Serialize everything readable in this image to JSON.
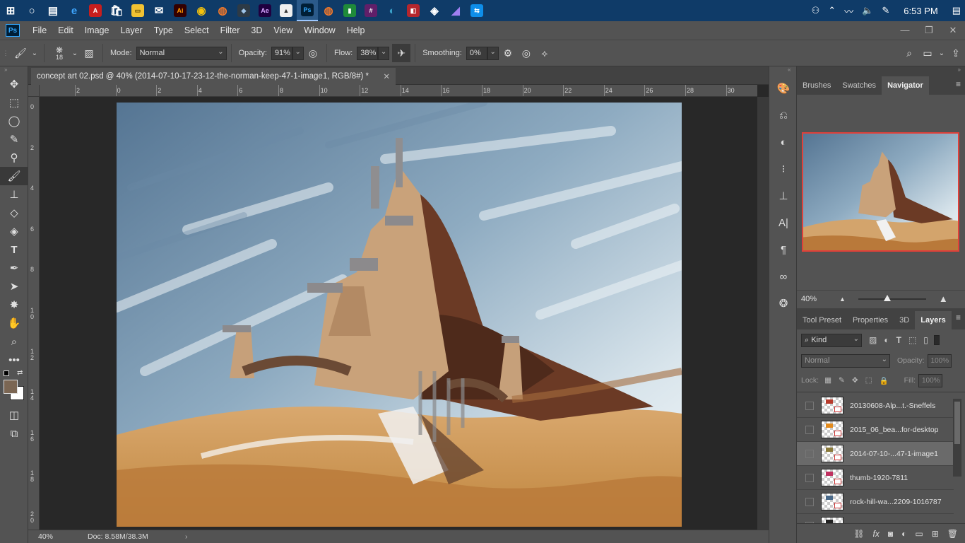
{
  "taskbar": {
    "apps": [
      {
        "icon": "windows-start-icon",
        "glyph": "⊞",
        "bg": "transparent",
        "fg": "#ffffff"
      },
      {
        "icon": "cortana-icon",
        "glyph": "○",
        "bg": "transparent",
        "fg": "#ffffff"
      },
      {
        "icon": "task-view-icon",
        "glyph": "▤",
        "bg": "transparent",
        "fg": "#ffffff"
      },
      {
        "icon": "edge-icon",
        "glyph": "e",
        "bg": "transparent",
        "fg": "#3ea6ff"
      },
      {
        "icon": "acrobat-icon",
        "glyph": "A",
        "bg": "#c81e1e",
        "fg": "#ffffff"
      },
      {
        "icon": "store-icon",
        "glyph": "🛍",
        "bg": "transparent",
        "fg": "#ffffff"
      },
      {
        "icon": "file-explorer-icon",
        "glyph": "▭",
        "bg": "#f1c232",
        "fg": "#5a4300"
      },
      {
        "icon": "mail-icon",
        "glyph": "✉",
        "bg": "transparent",
        "fg": "#ffffff"
      },
      {
        "icon": "illustrator-icon",
        "glyph": "Ai",
        "bg": "#330000",
        "fg": "#ff9a00"
      },
      {
        "icon": "chrome-icon",
        "glyph": "◉",
        "bg": "transparent",
        "fg": "#f4c20d"
      },
      {
        "icon": "blender-icon",
        "glyph": "◍",
        "bg": "transparent",
        "fg": "#f5792a"
      },
      {
        "icon": "app-icon",
        "glyph": "◆",
        "bg": "#2d3a46",
        "fg": "#9fc4e8"
      },
      {
        "icon": "after-effects-icon",
        "glyph": "Ae",
        "bg": "#1f0040",
        "fg": "#d7a3ff"
      },
      {
        "icon": "image-app-icon",
        "glyph": "▲",
        "bg": "#efefef",
        "fg": "#333333"
      },
      {
        "icon": "photoshop-icon",
        "glyph": "Ps",
        "bg": "#001e36",
        "fg": "#31a8ff",
        "active": true
      },
      {
        "icon": "blender-icon",
        "glyph": "◍",
        "bg": "transparent",
        "fg": "#f5792a"
      },
      {
        "icon": "app-green-icon",
        "glyph": "▮",
        "bg": "#1f8b3a",
        "fg": "#ffffff"
      },
      {
        "icon": "slack-icon",
        "glyph": "#",
        "bg": "#611f69",
        "fg": "#ffffff"
      },
      {
        "icon": "globe-icon",
        "glyph": "◐",
        "bg": "transparent",
        "fg": "#3aa0c8"
      },
      {
        "icon": "app-red-icon",
        "glyph": "◧",
        "bg": "#b5262d",
        "fg": "#ffffff"
      },
      {
        "icon": "unity-icon",
        "glyph": "◈",
        "bg": "transparent",
        "fg": "#ffffff"
      },
      {
        "icon": "visual-studio-icon",
        "glyph": "◢",
        "bg": "transparent",
        "fg": "#a07ff0"
      },
      {
        "icon": "teamviewer-icon",
        "glyph": "⇆",
        "bg": "#0e8ee9",
        "fg": "#ffffff"
      }
    ],
    "tray": {
      "clock": "6:53 PM"
    }
  },
  "menubar": {
    "logo": "Ps",
    "items": [
      "File",
      "Edit",
      "Image",
      "Layer",
      "Type",
      "Select",
      "Filter",
      "3D",
      "View",
      "Window",
      "Help"
    ]
  },
  "options": {
    "brush_size": "18",
    "mode_label": "Mode:",
    "mode_value": "Normal",
    "opacity_label": "Opacity:",
    "opacity_value": "91%",
    "flow_label": "Flow:",
    "flow_value": "38%",
    "smoothing_label": "Smoothing:",
    "smoothing_value": "0%"
  },
  "document": {
    "tab_title": "concept art 02.psd @ 40% (2014-07-10-17-23-12-the-norman-keep-47-1-image1, RGB/8#) *",
    "h_ruler": [
      "2",
      "0",
      "2",
      "4",
      "6",
      "8",
      "10",
      "12",
      "14",
      "16",
      "18",
      "20",
      "22",
      "24",
      "26",
      "28",
      "30"
    ],
    "v_ruler": [
      "0",
      "2",
      "4",
      "6",
      "8",
      "1 0",
      "1 2",
      "1 4",
      "1 6",
      "1 8",
      "2 0"
    ],
    "status_zoom": "40%",
    "status_doc": "Doc: 8.58M/38.3M"
  },
  "right_panel": {
    "top_tabs": [
      "Brushes",
      "Swatches",
      "Navigator"
    ],
    "navigator_zoom": "40%",
    "layer_tabs": [
      "Tool Preset",
      "Properties",
      "3D",
      "Layers"
    ],
    "filter_kind": "Kind",
    "blend_mode": "Normal",
    "opacity_label": "Opacity:",
    "opacity_value": "100%",
    "lock_label": "Lock:",
    "fill_label": "Fill:",
    "fill_value": "100%",
    "layers": [
      {
        "name": "20130608-Alp...t.-Sneffels",
        "selected": false,
        "color": "#b83b2c"
      },
      {
        "name": "2015_06_bea...for-desktop",
        "selected": false,
        "color": "#e38b1d"
      },
      {
        "name": "2014-07-10-...47-1-image1",
        "selected": true,
        "color": "#8a7a3a"
      },
      {
        "name": "thumb-1920-7811",
        "selected": false,
        "color": "#c03060"
      },
      {
        "name": "rock-hill-wa...2209-1016787",
        "selected": false,
        "color": "#4a6a8a"
      },
      {
        "name": "...",
        "selected": false,
        "color": "#222222"
      }
    ]
  }
}
